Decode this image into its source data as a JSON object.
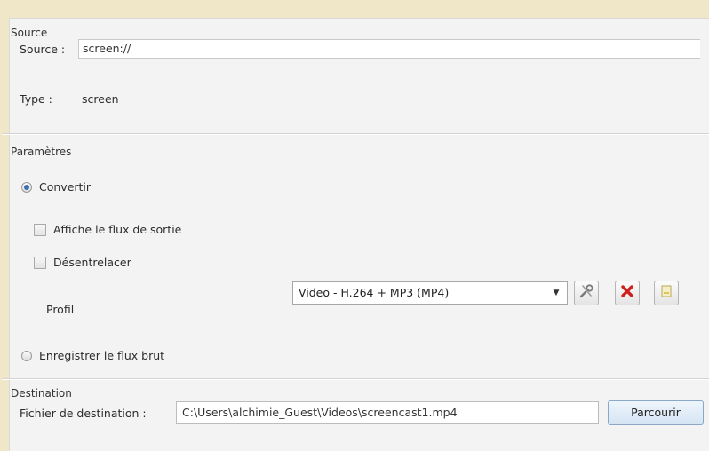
{
  "source_group": {
    "title": "Source",
    "source_label": "Source :",
    "source_value": "screen://",
    "type_label": "Type :",
    "type_value": "screen"
  },
  "params_group": {
    "title": "Paramètres",
    "convert_label": "Convertir",
    "convert_checked": true,
    "show_output_label": "Affiche le flux de sortie",
    "deinterlace_label": "Désentrelacer",
    "profile_label": "Profil",
    "profile_value": "Video - H.264 + MP3 (MP4)",
    "record_raw_label": "Enregistrer le flux brut"
  },
  "dest_group": {
    "title": "Destination",
    "file_label": "Fichier de destination :",
    "file_value": "C:\\Users\\alchimie_Guest\\Videos\\screencast1.mp4",
    "browse_label": "Parcourir"
  },
  "icons": {
    "edit_profile": "wrench-icon",
    "delete_profile": "red-x-icon",
    "new_profile": "new-document-icon"
  },
  "colors": {
    "radio_accent": "#3a6fb0",
    "delete_red": "#d0201b"
  }
}
